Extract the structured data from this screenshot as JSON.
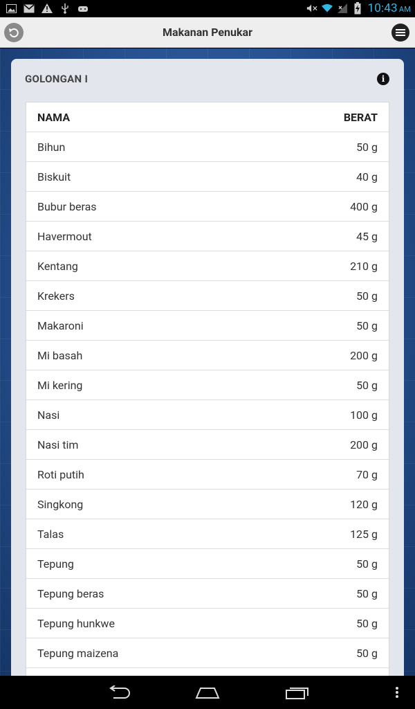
{
  "status_bar": {
    "time": "10:43",
    "ampm": "AM",
    "left_icons": [
      "image-icon",
      "mail-icon",
      "warning-icon",
      "usb-icon",
      "android-icon"
    ],
    "right_icons": [
      "mute-icon",
      "wifi-icon",
      "signal-icon",
      "battery-icon"
    ]
  },
  "action_bar": {
    "title": "Makanan Penukar"
  },
  "card": {
    "group_title": "GOLONGAN I",
    "info_label": "i"
  },
  "table": {
    "headers": {
      "name": "NAMA",
      "weight": "BERAT"
    },
    "rows": [
      {
        "name": "Bihun",
        "weight": "50 g"
      },
      {
        "name": "Biskuit",
        "weight": "40 g"
      },
      {
        "name": "Bubur beras",
        "weight": "400 g"
      },
      {
        "name": "Havermout",
        "weight": "45 g"
      },
      {
        "name": "Kentang",
        "weight": "210 g"
      },
      {
        "name": "Krekers",
        "weight": "50 g"
      },
      {
        "name": "Makaroni",
        "weight": "50 g"
      },
      {
        "name": "Mi basah",
        "weight": "200 g"
      },
      {
        "name": "Mi kering",
        "weight": "50 g"
      },
      {
        "name": "Nasi",
        "weight": "100 g"
      },
      {
        "name": "Nasi tim",
        "weight": "200 g"
      },
      {
        "name": "Roti putih",
        "weight": "70 g"
      },
      {
        "name": "Singkong",
        "weight": "120 g"
      },
      {
        "name": "Talas",
        "weight": "125 g"
      },
      {
        "name": "Tepung",
        "weight": "50 g"
      },
      {
        "name": "Tepung beras",
        "weight": "50 g"
      },
      {
        "name": "Tepung hunkwe",
        "weight": "50 g"
      },
      {
        "name": "Tepung maizena",
        "weight": "50 g"
      }
    ]
  },
  "colors": {
    "clock": "#33b5e5",
    "action_bar_bg": "#eeeeee",
    "background_blue": "#26508f",
    "card_bg": "#e4e6ee"
  }
}
